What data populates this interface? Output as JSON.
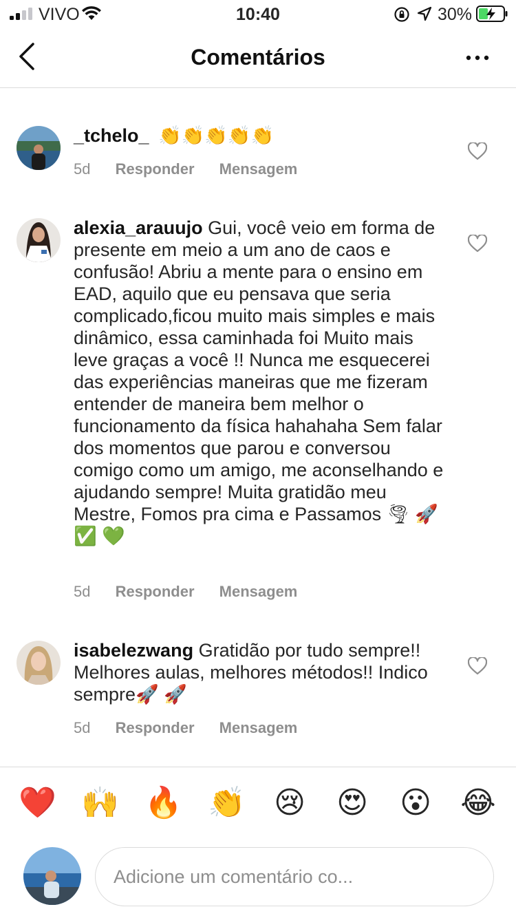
{
  "status_bar": {
    "carrier": "VIVO",
    "time": "10:40",
    "battery": "30%"
  },
  "header": {
    "title": "Comentários"
  },
  "comments": [
    {
      "username": "_tchelo_",
      "text": "👏👏👏👏👏",
      "age": "5d",
      "reply_label": "Responder",
      "message_label": "Mensagem"
    },
    {
      "username": "alexia_arauujo",
      "text": "Gui, você veio em forma de presente em meio a um ano de caos e confusão! Abriu a mente para o ensino em EAD, aquilo que eu pensava que seria complicado,ficou muito mais simples e mais dinâmico, essa caminhada foi Muito mais leve graças a você !! Nunca me esquecerei das experiências maneiras que me fizeram entender de maneira bem melhor o funcionamento da física hahahaha Sem falar dos momentos que parou e conversou comigo como um amigo, me aconselhando e ajudando sempre! Muita gratidão meu Mestre, Fomos pra cima e Passamos 🌪 🚀 ✅ 💚",
      "age": "5d",
      "reply_label": "Responder",
      "message_label": "Mensagem"
    },
    {
      "username": "isabelezwang",
      "text": "Gratidão por tudo sempre!! Melhores aulas, melhores métodos!! Indico sempre🚀 🚀",
      "age": "5d",
      "reply_label": "Responder",
      "message_label": "Mensagem"
    }
  ],
  "reactions": [
    "❤️",
    "🙌",
    "🔥",
    "👏",
    "😢",
    "😍",
    "😮",
    "😂"
  ],
  "composer": {
    "placeholder": "Adicione um comentário co..."
  },
  "colors": {
    "text": "#262626",
    "muted": "#8e8e8e",
    "divider": "#dbdbdb",
    "battery": "#4cd964"
  }
}
